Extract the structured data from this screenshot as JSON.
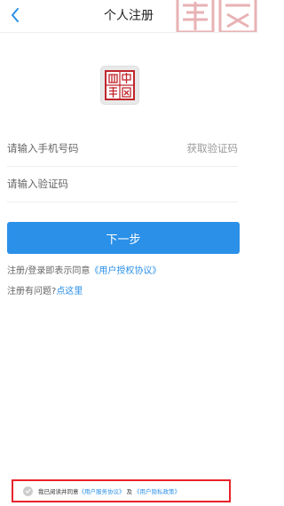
{
  "nav": {
    "title": "个人注册",
    "back_icon": "chevron-left-icon",
    "watermark_icon": "seal-watermark-icon"
  },
  "logo": {
    "icon": "seal-logo-icon"
  },
  "form": {
    "phone_placeholder": "请输入手机号码",
    "get_code_label": "获取验证码",
    "code_placeholder": "请输入验证码"
  },
  "next_button": {
    "label": "下一步"
  },
  "terms_line": {
    "prefix": "注册/登录即表示同意",
    "link": "《用户授权协议》"
  },
  "help_line": {
    "prefix": "注册有问题?",
    "link": "点这里"
  },
  "agreement": {
    "checkbox_icon": "check-circle-icon",
    "prefix": "我已阅读并同意",
    "service_link": "《用户服务协议》",
    "joiner": "及",
    "privacy_link": "《用户隐私政策》"
  },
  "colors": {
    "accent": "#2b90e8",
    "seal_red": "#c0262c",
    "highlight_border": "#e8222a",
    "divider": "#eeeeee"
  }
}
